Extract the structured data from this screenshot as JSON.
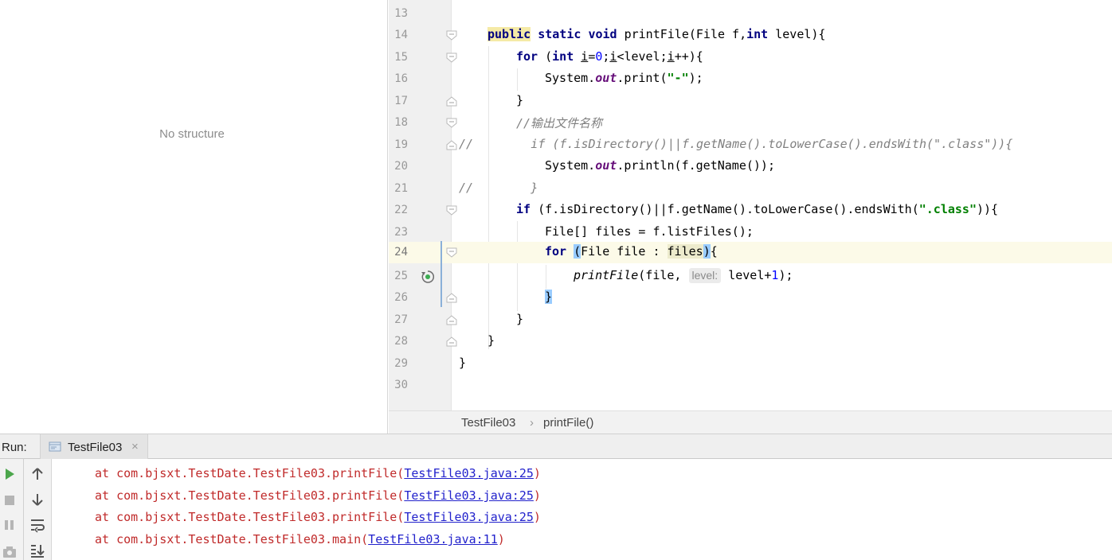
{
  "structure_panel": {
    "empty_text": "No structure"
  },
  "editor": {
    "line_numbers": [
      "13",
      "14",
      "15",
      "16",
      "17",
      "18",
      "19",
      "20",
      "21",
      "22",
      "23",
      "24",
      "25",
      "26",
      "27",
      "28",
      "29",
      "30"
    ],
    "code": {
      "l14": {
        "public": "public",
        "static": "static",
        "void": "void",
        "sig": " printFile(File f,",
        "int": "int",
        "rest": " level){"
      },
      "l15": {
        "for": "for",
        "a": " (",
        "int": "int",
        "b": " ",
        "i1": "i",
        "c": "=",
        "zero": "0",
        "d": ";",
        "i2": "i",
        "e": "<level;",
        "i3": "i",
        "f": "++){"
      },
      "l16": {
        "a": "System.",
        "out": "out",
        "b": ".print(",
        "str": "\"-\"",
        "c": ");"
      },
      "l17": "}",
      "l18": "//输出文件名称",
      "l19": "//        if (f.isDirectory()||f.getName().toLowerCase().endsWith(\".class\")){",
      "l20": {
        "a": "System.",
        "out": "out",
        "b": ".println(f.getName());"
      },
      "l21": "//        }",
      "l22": {
        "if": "if",
        "a": " (f.isDirectory()||f.getName().toLowerCase().endsWith(",
        "str": "\".class\"",
        "b": ")){"
      },
      "l23": "File[] files = f.listFiles();",
      "l24": {
        "for": "for",
        "a": " ",
        "paren": "(",
        "b": "File file : ",
        "files": "files",
        "close": ")",
        "c": "{"
      },
      "l25": {
        "call": "printFile",
        "a": "(file,",
        "hint": "level:",
        "b": " level+",
        "one": "1",
        "c": ");"
      },
      "l26": "}",
      "l27": "}",
      "l28": "}",
      "l29": "}"
    }
  },
  "breadcrumb": {
    "class_name": "TestFile03",
    "separator": "›",
    "method_name": "printFile()"
  },
  "run_panel": {
    "label": "Run:",
    "tab_label": "TestFile03",
    "tab_close": "×",
    "console_lines": [
      {
        "prefix": "at com.bjsxt.TestDate.TestFile03.printFile(",
        "link": "TestFile03.java:25",
        "suffix": ")"
      },
      {
        "prefix": "at com.bjsxt.TestDate.TestFile03.printFile(",
        "link": "TestFile03.java:25",
        "suffix": ")"
      },
      {
        "prefix": "at com.bjsxt.TestDate.TestFile03.printFile(",
        "link": "TestFile03.java:25",
        "suffix": ")"
      },
      {
        "prefix": "at com.bjsxt.TestDate.TestFile03.main(",
        "link": "TestFile03.java:11",
        "suffix": ")"
      }
    ]
  },
  "icons": {
    "run": "play-icon",
    "stop": "stop-icon",
    "pause": "pause-icon",
    "dump": "camera-icon",
    "up": "arrow-up-icon",
    "down": "arrow-down-icon",
    "wrap": "soft-wrap-icon",
    "scroll_end": "scroll-to-end-icon",
    "recursion": "recursive-call-icon",
    "fold": "fold-marker-icon"
  },
  "colors": {
    "keyword": "#000080",
    "string": "#008000",
    "number": "#0000ff",
    "field": "#660e7a",
    "comment": "#808080",
    "error_text": "#c02a2a",
    "link": "#2222cc",
    "current_line": "#fcfae8"
  }
}
